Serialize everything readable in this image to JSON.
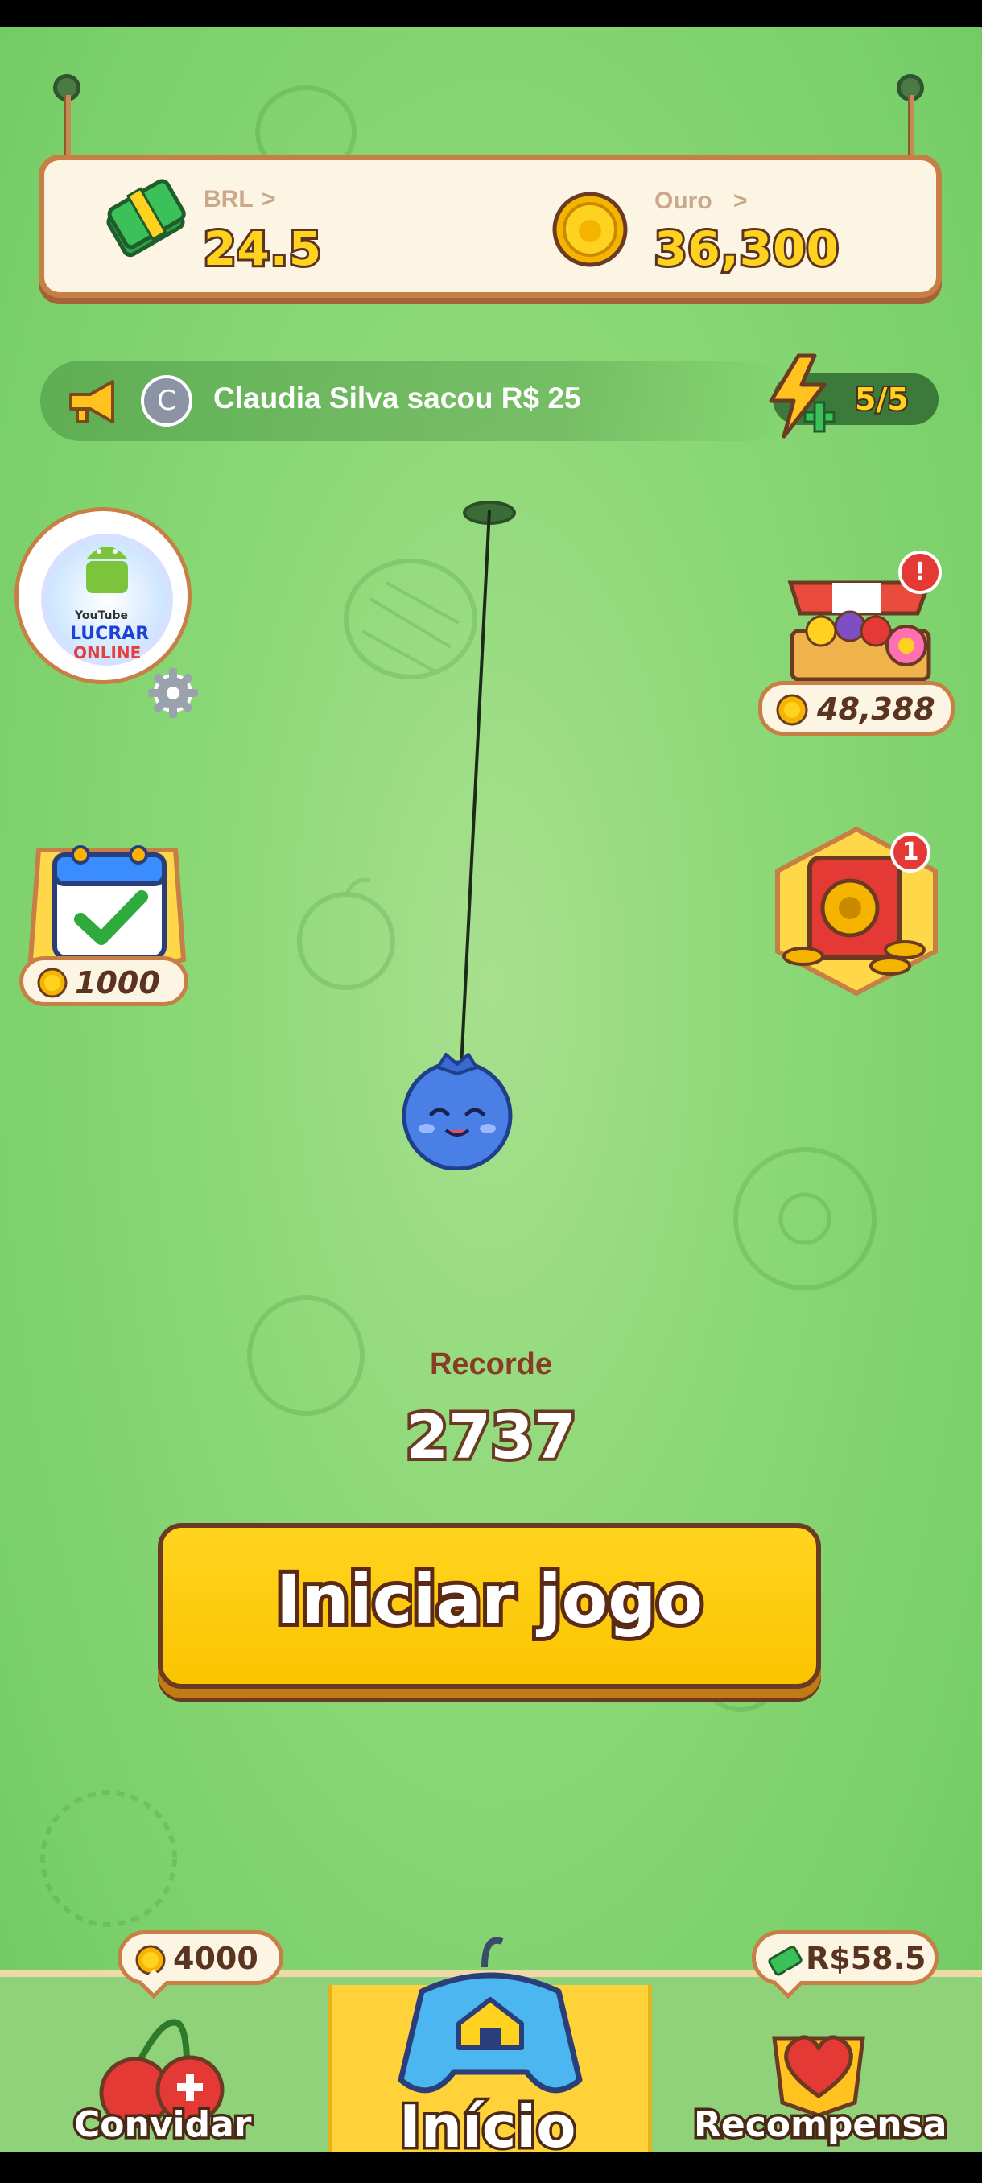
{
  "currency": {
    "brl_label": "BRL",
    "brl_value": "24.5",
    "gold_label": "Ouro",
    "gold_value": "36,300",
    "chevron": ">"
  },
  "ticker": {
    "avatar_initial": "C",
    "message": "Claudia Silva sacou R$ 25"
  },
  "energy": {
    "value": "5/5"
  },
  "side_left": {
    "profile_lines": [
      "YouTube",
      "LUCRAR",
      "ONLINE"
    ],
    "daily_coins": "1000"
  },
  "side_right": {
    "market_coins": "48,388",
    "market_badge": "!",
    "vault_badge": "1"
  },
  "record": {
    "label": "Recorde",
    "value": "2737"
  },
  "start_button": {
    "label": "Iniciar jogo"
  },
  "nav": {
    "invite_label": "Convidar",
    "invite_bubble": "4000",
    "home_label": "Início",
    "reward_label": "Recompensa",
    "reward_bubble": "R$58.5"
  },
  "colors": {
    "background": "#8cd877",
    "gold": "#ffd21f",
    "outline": "#5a3420",
    "board": "#fdf5e3",
    "board_border": "#c77f45",
    "blueberry": "#4a7fe6"
  },
  "icons": {
    "brl": "money-stack-icon",
    "gold": "gold-coin-icon",
    "announce": "megaphone-icon",
    "energy": "lightning-plus-icon",
    "settings": "gear-icon",
    "daily": "calendar-check-icon",
    "market": "fruit-stand-icon",
    "vault": "safe-coins-icon",
    "invite": "cherries-plus-icon",
    "home": "gamepad-house-icon",
    "reward": "heart-medal-icon"
  }
}
